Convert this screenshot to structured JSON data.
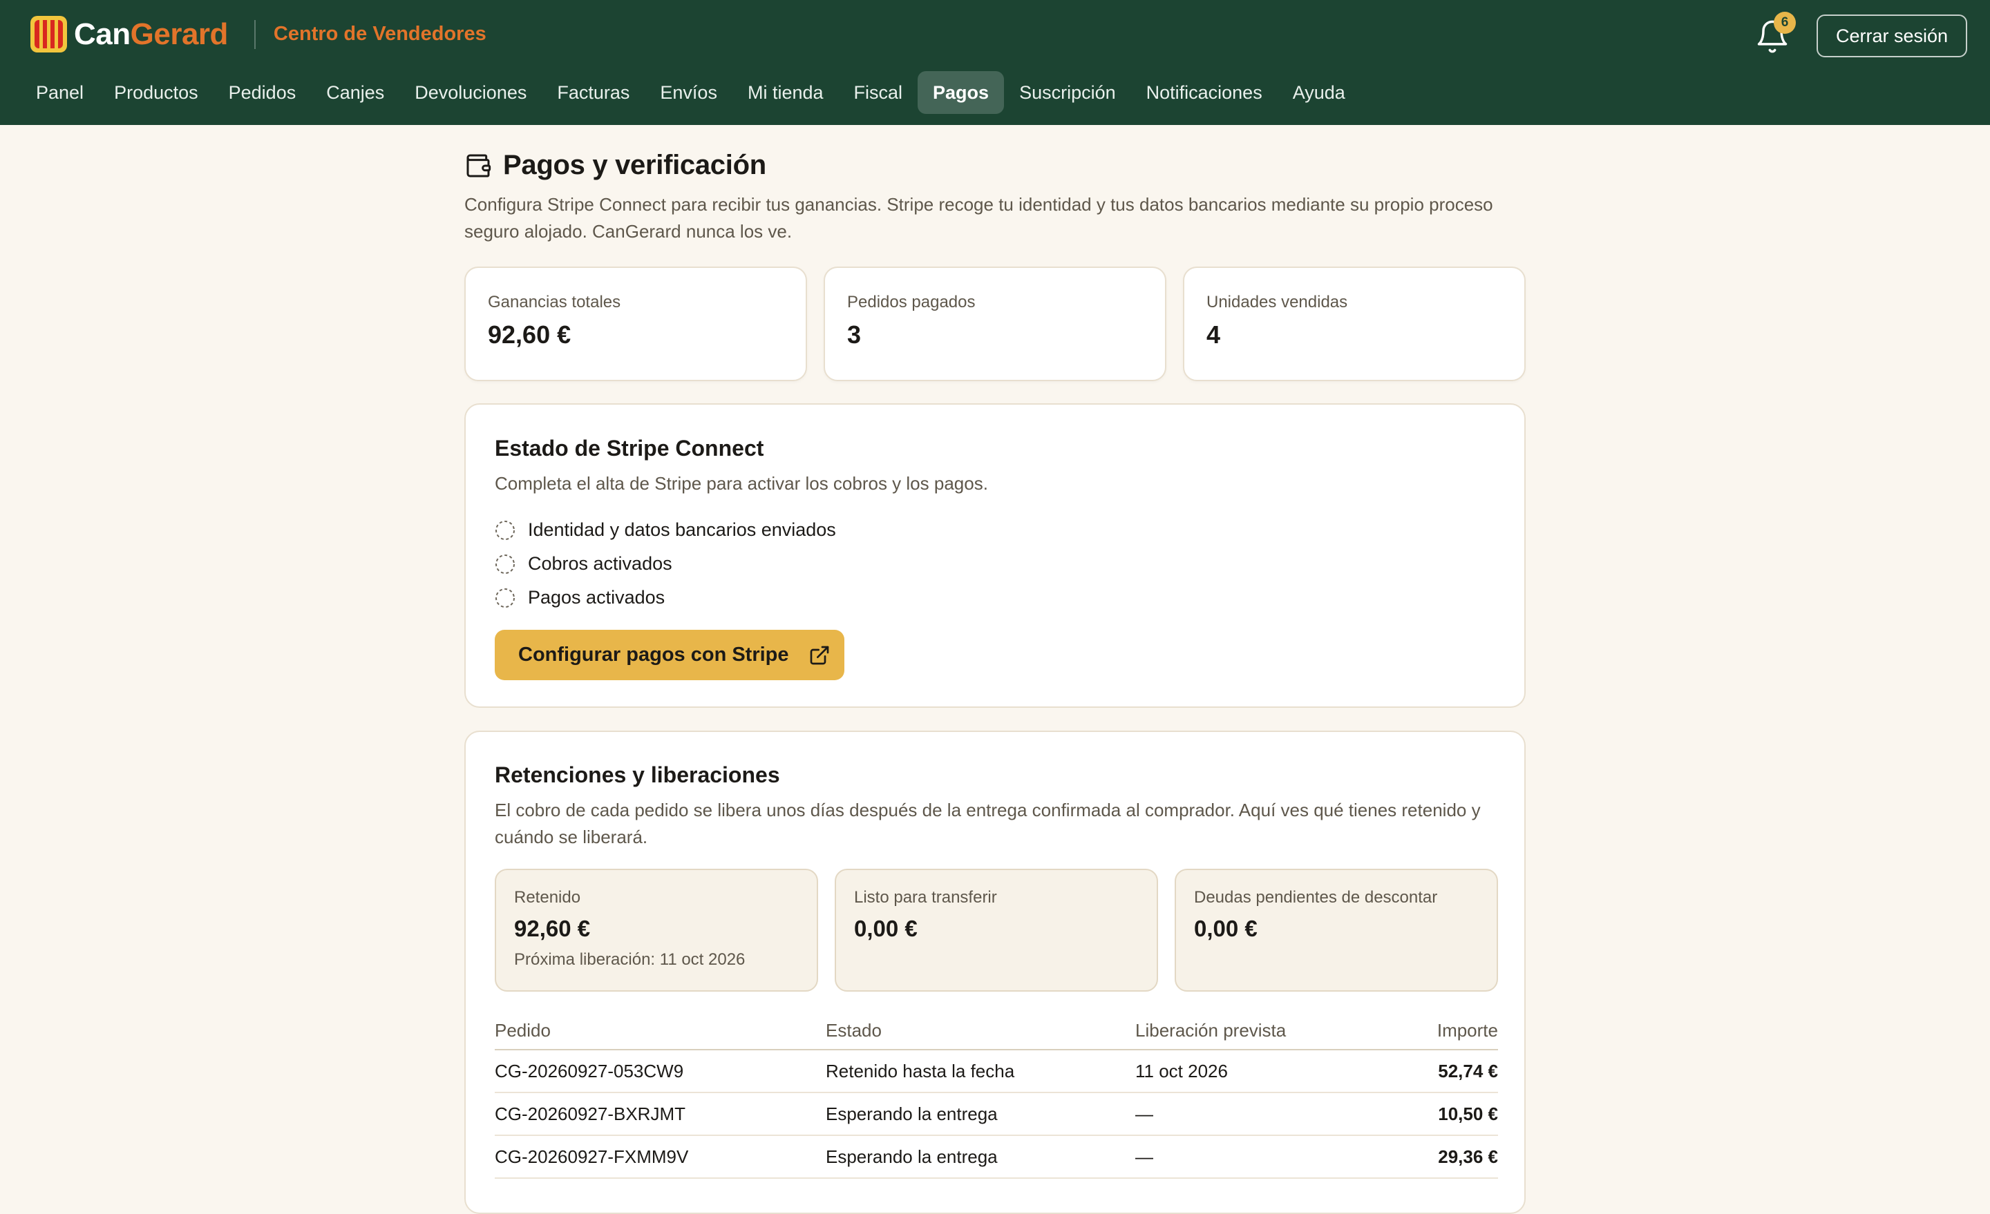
{
  "header": {
    "brand_part1": "Can",
    "brand_part2": "Gerard",
    "portal_name": "Centro de Vendedores",
    "notification_count": "6",
    "logout_label": "Cerrar sesión",
    "nav": [
      {
        "label": "Panel",
        "active": false
      },
      {
        "label": "Productos",
        "active": false
      },
      {
        "label": "Pedidos",
        "active": false
      },
      {
        "label": "Canjes",
        "active": false
      },
      {
        "label": "Devoluciones",
        "active": false
      },
      {
        "label": "Facturas",
        "active": false
      },
      {
        "label": "Envíos",
        "active": false
      },
      {
        "label": "Mi tienda",
        "active": false
      },
      {
        "label": "Fiscal",
        "active": false
      },
      {
        "label": "Pagos",
        "active": true
      },
      {
        "label": "Suscripción",
        "active": false
      },
      {
        "label": "Notificaciones",
        "active": false
      },
      {
        "label": "Ayuda",
        "active": false
      }
    ]
  },
  "page": {
    "title": "Pagos y verificación",
    "description": "Configura Stripe Connect para recibir tus ganancias. Stripe recoge tu identidad y tus datos bancarios mediante su propio proceso seguro alojado. CanGerard nunca los ve."
  },
  "stats": [
    {
      "label": "Ganancias totales",
      "value": "92,60 €"
    },
    {
      "label": "Pedidos pagados",
      "value": "3"
    },
    {
      "label": "Unidades vendidas",
      "value": "4"
    }
  ],
  "stripe": {
    "title": "Estado de Stripe Connect",
    "subtitle": "Completa el alta de Stripe para activar los cobros y los pagos.",
    "checks": [
      {
        "label": "Identidad y datos bancarios enviados",
        "done": false
      },
      {
        "label": "Cobros activados",
        "done": false
      },
      {
        "label": "Pagos activados",
        "done": false
      }
    ],
    "button_label": "Configurar pagos con Stripe"
  },
  "holds": {
    "title": "Retenciones y liberaciones",
    "subtitle": "El cobro de cada pedido se libera unos días después de la entrega confirmada al comprador. Aquí ves qué tienes retenido y cuándo se liberará.",
    "balances": [
      {
        "label": "Retenido",
        "value": "92,60 €",
        "note": "Próxima liberación: 11 oct 2026"
      },
      {
        "label": "Listo para transferir",
        "value": "0,00 €",
        "note": ""
      },
      {
        "label": "Deudas pendientes de descontar",
        "value": "0,00 €",
        "note": ""
      }
    ],
    "columns": [
      "Pedido",
      "Estado",
      "Liberación prevista",
      "Importe"
    ],
    "rows": [
      {
        "order": "CG-20260927-053CW9",
        "status": "Retenido hasta la fecha",
        "release": "11 oct 2026",
        "amount": "52,74 €"
      },
      {
        "order": "CG-20260927-BXRJMT",
        "status": "Esperando la entrega",
        "release": "—",
        "amount": "10,50 €"
      },
      {
        "order": "CG-20260927-FXMM9V",
        "status": "Esperando la entrega",
        "release": "—",
        "amount": "29,36 €"
      }
    ]
  },
  "colors": {
    "header_bg": "#1c4432",
    "brand_orange": "#e2742a",
    "accent_yellow": "#e8b64a",
    "page_bg": "#faf6ef"
  }
}
